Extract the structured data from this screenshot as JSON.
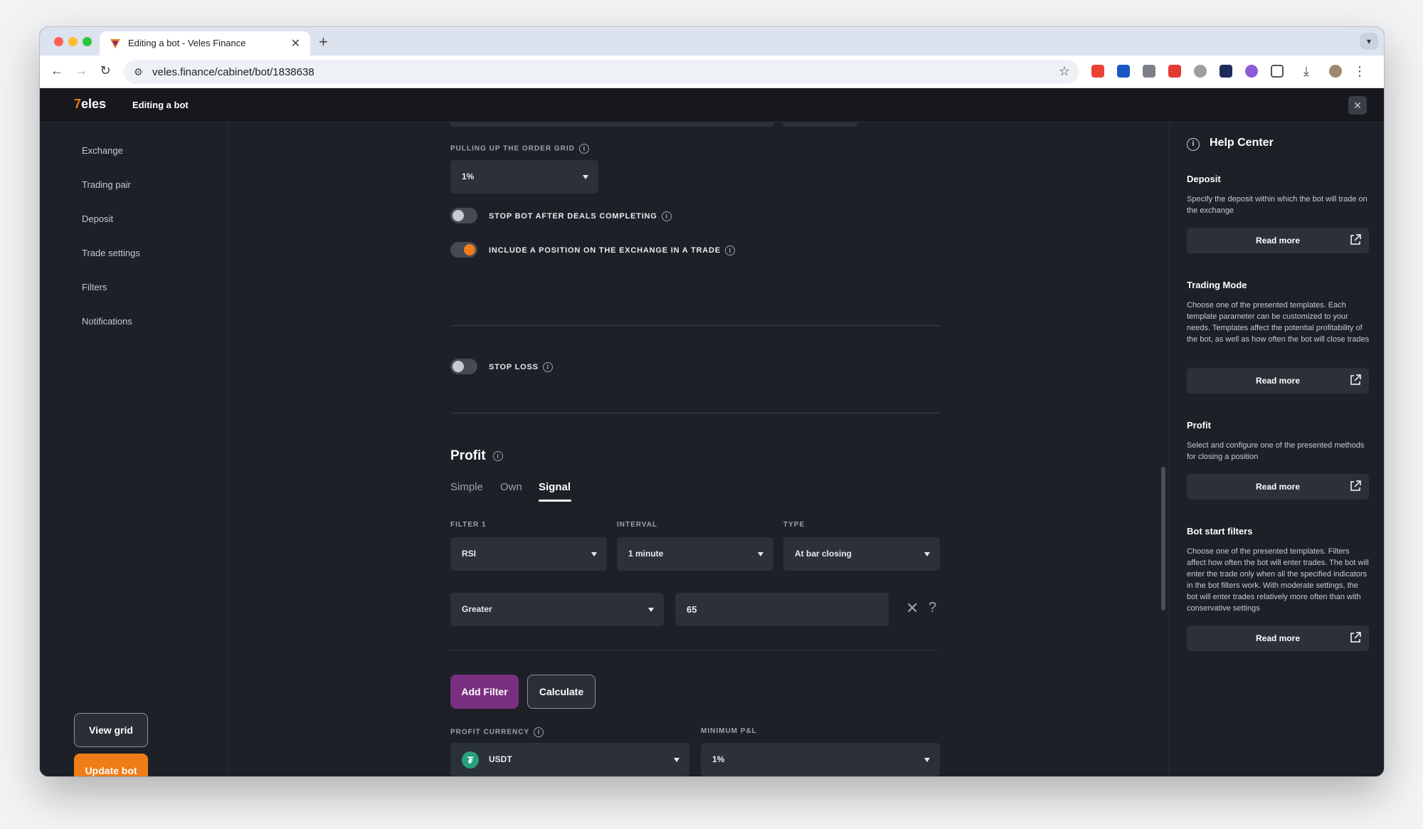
{
  "browser": {
    "tab_title": "Editing a bot - Veles Finance",
    "url": "veles.finance/cabinet/bot/1838638",
    "tab_close": "✕",
    "new_tab": "+"
  },
  "header": {
    "logo_mark": "7",
    "logo_text": "eles",
    "title": "Editing a bot"
  },
  "sidebar": {
    "items": [
      {
        "label": "Exchange"
      },
      {
        "label": "Trading pair"
      },
      {
        "label": "Deposit"
      },
      {
        "label": "Trade settings"
      },
      {
        "label": "Filters"
      },
      {
        "label": "Notifications"
      }
    ],
    "view_grid_label": "View grid",
    "update_bot_label": "Update bot"
  },
  "form": {
    "pulling_up_label": "PULLING UP THE ORDER GRID",
    "pulling_up_value": "1%",
    "stop_after_deals_label": "STOP BOT AFTER DEALS COMPLETING",
    "stop_after_deals_on": false,
    "include_position_label": "INCLUDE A POSITION ON THE EXCHANGE IN A TRADE",
    "include_position_on": true,
    "stop_loss_label": "STOP LOSS",
    "stop_loss_on": false,
    "profit": {
      "title": "Profit",
      "tabs": [
        {
          "label": "Simple"
        },
        {
          "label": "Own"
        },
        {
          "label": "Signal"
        }
      ],
      "active_tab": "Signal",
      "filter_label": "FILTER 1",
      "filter_value": "RSI",
      "interval_label": "INTERVAL",
      "interval_value": "1 minute",
      "type_label": "TYPE",
      "type_value": "At bar closing",
      "condition_value": "Greater",
      "threshold_value": "65",
      "add_filter_label": "Add Filter",
      "calculate_label": "Calculate",
      "currency_label": "PROFIT CURRENCY",
      "currency_value": "USDT",
      "currency_icon": "₮",
      "min_pnl_label": "MINIMUM P&L",
      "min_pnl_value": "1%"
    }
  },
  "help_center": {
    "title": "Help Center",
    "sections": [
      {
        "title": "Deposit",
        "text": "Specify the deposit within which the bot will trade on the exchange",
        "button": "Read more"
      },
      {
        "title": "Trading Mode",
        "text": "Choose one of the presented templates. Each template parameter can be customized to your needs. Templates affect the potential profitability of the bot, as well as how often the bot will close trades",
        "button": "Read more"
      },
      {
        "title": "Profit",
        "text": "Select and configure one of the presented methods for closing a position",
        "button": "Read more"
      },
      {
        "title": "Bot start filters",
        "text": "Choose one of the presented templates. Filters affect how often the bot will enter trades. The bot will enter the trade only when all the specified indicators in the bot filters work. With moderate settings, the bot will enter trades relatively more often than with conservative settings",
        "button": "Read more"
      }
    ]
  },
  "colors": {
    "accent": "#ef7c17",
    "add_filter": "#7a2f80",
    "background": "#1d2027",
    "tether": "#26a17b"
  }
}
